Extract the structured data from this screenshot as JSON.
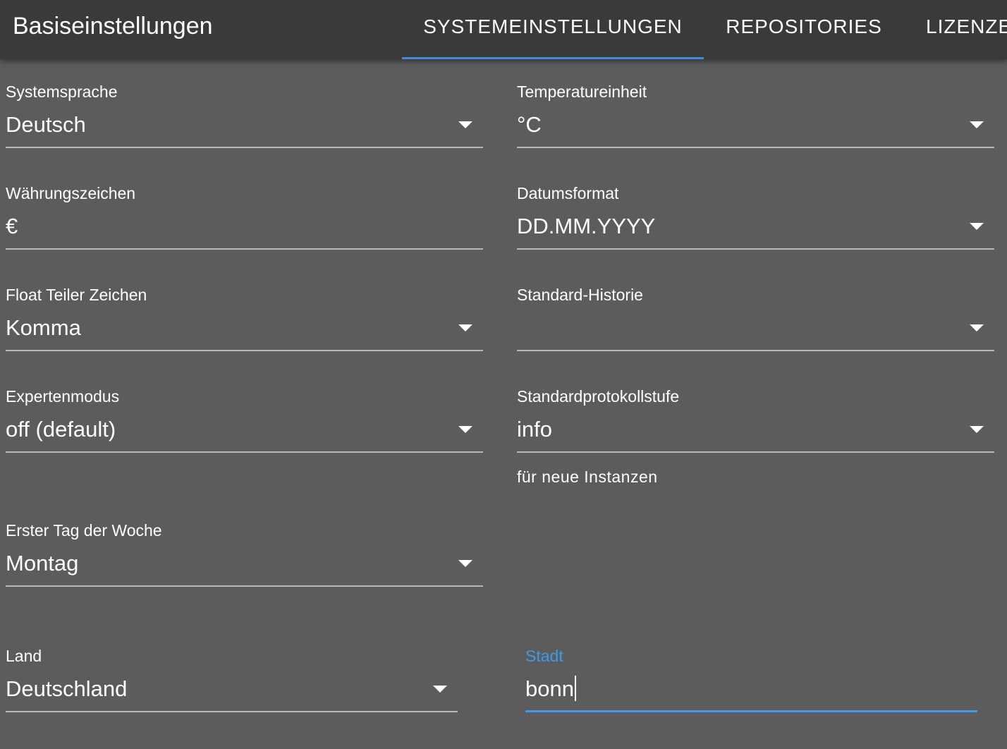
{
  "header": {
    "title": "Basiseinstellungen",
    "tabs": [
      {
        "label": "SYSTEMEINSTELLUNGEN",
        "active": true
      },
      {
        "label": "REPOSITORIES",
        "active": false
      },
      {
        "label": "LIZENZE",
        "active": false
      }
    ],
    "accent_color": "#3d8ee0"
  },
  "form": {
    "system_language": {
      "label": "Systemsprache",
      "value": "Deutsch"
    },
    "temperature_unit": {
      "label": "Temperatureinheit",
      "value": "°C"
    },
    "currency_sign": {
      "label": "Währungszeichen",
      "value": "€"
    },
    "date_format": {
      "label": "Datumsformat",
      "value": "DD.MM.YYYY"
    },
    "float_separator": {
      "label": "Float Teiler Zeichen",
      "value": "Komma"
    },
    "default_history": {
      "label": "Standard-Historie",
      "value": ""
    },
    "expert_mode": {
      "label": "Expertenmodus",
      "value": "off (default)"
    },
    "default_log_level": {
      "label": "Standardprotokollstufe",
      "value": "info",
      "helper": "für neue Instanzen"
    },
    "first_day_of_week": {
      "label": "Erster Tag der Woche",
      "value": "Montag"
    },
    "country": {
      "label": "Land",
      "value": "Deutschland"
    },
    "city": {
      "label": "Stadt",
      "value": "bonn",
      "focused": true
    }
  },
  "colors": {
    "background": "#5c5c5c",
    "header_background": "#3a3a3a",
    "focus": "#3d9be9",
    "underline": "#b9b9b9"
  }
}
